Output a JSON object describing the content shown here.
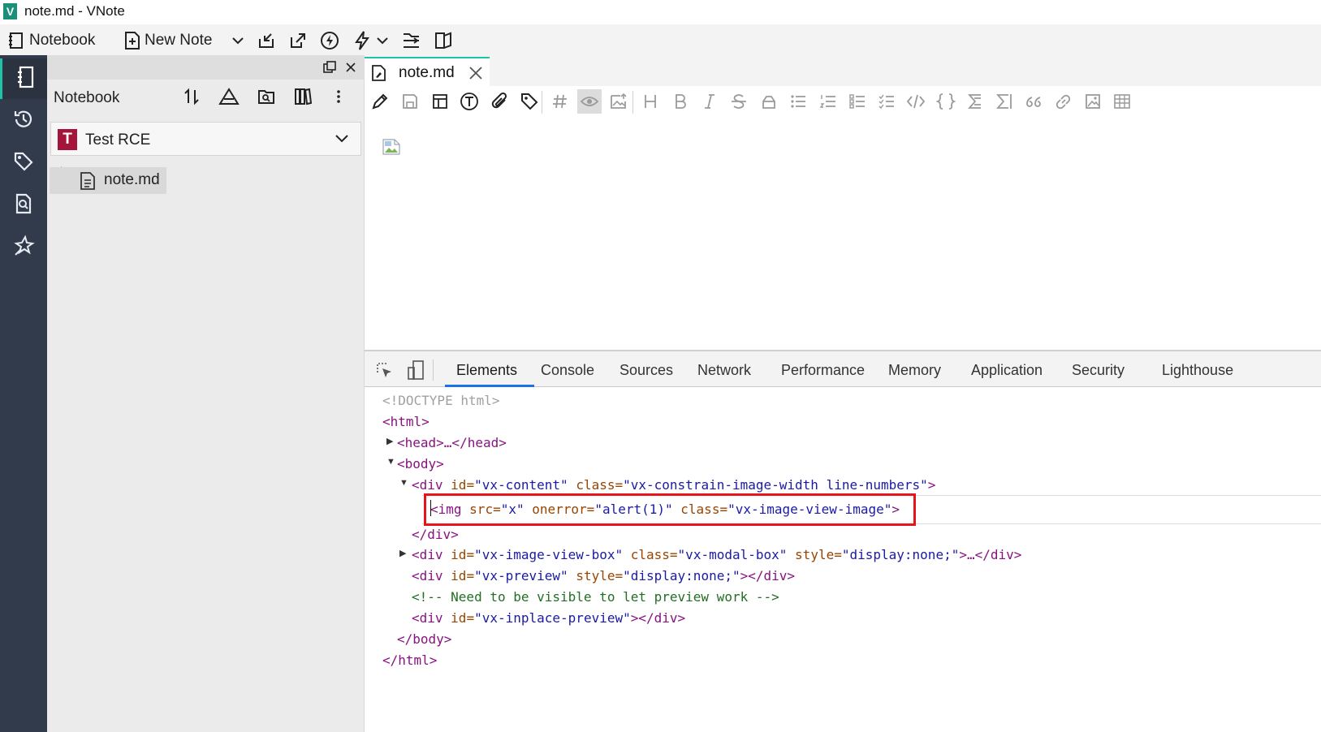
{
  "window": {
    "title": "note.md - VNote",
    "logo_letter": "V"
  },
  "main_toolbar": {
    "notebook_label": "Notebook",
    "new_note_label": "New Note"
  },
  "notebook_panel": {
    "title": "Notebook",
    "selected_notebook": "Test RCE",
    "notebook_badge": "T",
    "tree": [
      {
        "label": "note.md"
      }
    ]
  },
  "editor": {
    "tab_label": "note.md"
  },
  "devtools": {
    "tabs": [
      "Elements",
      "Console",
      "Sources",
      "Network",
      "Performance",
      "Memory",
      "Application",
      "Security",
      "Lighthouse"
    ],
    "active_tab": "Elements",
    "dom": {
      "doctype": "<!DOCTYPE html>",
      "html_open": "<html>",
      "head": "<head>…</head>",
      "body_open": "<body>",
      "div_content_tag": "<div",
      "div_content_id_attr": "id=",
      "div_content_id_val": "\"vx-content\"",
      "div_content_class_attr": "class=",
      "div_content_class_val": "\"vx-constrain-image-width line-numbers\"",
      "img_tag": "<img",
      "img_src_attr": "src=",
      "img_src_val": "\"x\"",
      "img_onerror_attr": "onerror=",
      "img_onerror_val": "\"alert(1)\"",
      "img_class_attr": "class=",
      "img_class_val": "\"vx-image-view-image\"",
      "div_close": "</div>",
      "div_viewbox_id_val": "\"vx-image-view-box\"",
      "div_viewbox_class_val": "\"vx-modal-box\"",
      "div_viewbox_style_attr": "style=",
      "div_viewbox_style_val": "\"display:none;\"",
      "div_viewbox_tail": ">…</div>",
      "div_preview_id_val": "\"vx-preview\"",
      "div_preview_style_val": "\"display:none;\"",
      "div_preview_tail": "></div>",
      "comment": "<!-- Need to be visible to let preview work -->",
      "div_inplace_id_val": "\"vx-inplace-preview\"",
      "div_inplace_tail": "></div>",
      "body_close": "</body>",
      "html_close": "</html>",
      "gt": ">"
    }
  },
  "colors": {
    "accent": "#1ec3a8",
    "activity_bar": "#323b4c",
    "highlight_box": "#e8141b",
    "notebook_badge": "#a4143b"
  }
}
